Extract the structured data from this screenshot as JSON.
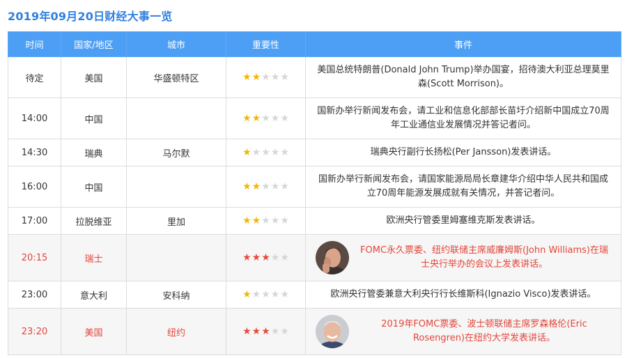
{
  "page": {
    "title": "2019年09月20日财经大事一览"
  },
  "table": {
    "headers": [
      "时间",
      "国家/地区",
      "城市",
      "重要性",
      "事件"
    ],
    "rows": [
      {
        "time": "待定",
        "country": "美国",
        "city": "华盛顿特区",
        "importance": 2,
        "important": false,
        "avatar": null,
        "event": "美国总统特朗普(Donald John Trump)举办国宴，招待澳大利亚总理莫里森(Scott Morrison)。"
      },
      {
        "time": "14:00",
        "country": "中国",
        "city": "",
        "importance": 2,
        "important": false,
        "avatar": null,
        "event": "国新办举行新闻发布会，请工业和信息化部部长苗圩介绍新中国成立70周年工业通信业发展情况并答记者问。"
      },
      {
        "time": "14:30",
        "country": "瑞典",
        "city": "马尔默",
        "importance": 1,
        "important": false,
        "avatar": null,
        "event": "瑞典央行副行长扬松(Per Jansson)发表讲话。"
      },
      {
        "time": "16:00",
        "country": "中国",
        "city": "",
        "importance": 2,
        "important": false,
        "avatar": null,
        "event": "国新办举行新闻发布会，请国家能源局局长章建华介绍中华人民共和国成立70周年能源发展成就有关情况，并答记者问。"
      },
      {
        "time": "17:00",
        "country": "拉脱维亚",
        "city": "里加",
        "importance": 2,
        "important": false,
        "avatar": null,
        "event": "欧洲央行管委里姆塞维克斯发表讲话。"
      },
      {
        "time": "20:15",
        "country": "瑞士",
        "city": "",
        "importance": 3,
        "important": true,
        "avatar": "person-photo-1",
        "event": "FOMC永久票委、纽约联储主席威廉姆斯(John Williams)在瑞士央行举办的会议上发表讲话。"
      },
      {
        "time": "23:00",
        "country": "意大利",
        "city": "安科纳",
        "importance": 1,
        "important": false,
        "avatar": null,
        "event": "欧洲央行管委兼意大利央行行长维斯科(Ignazio Visco)发表讲话。"
      },
      {
        "time": "23:20",
        "country": "美国",
        "city": "纽约",
        "importance": 3,
        "important": true,
        "avatar": "person-photo-2",
        "event": "2019年FOMC票委、波士顿联储主席罗森格伦(Eric Rosengren)在纽约大学发表讲话。"
      }
    ],
    "star_max": 5
  },
  "colors": {
    "header_bg": "#4d9ff5",
    "title": "#2f7fe0",
    "important_text": "#e2463a",
    "star_on": "#f2b600",
    "star_on_important": "#e64a3c"
  }
}
